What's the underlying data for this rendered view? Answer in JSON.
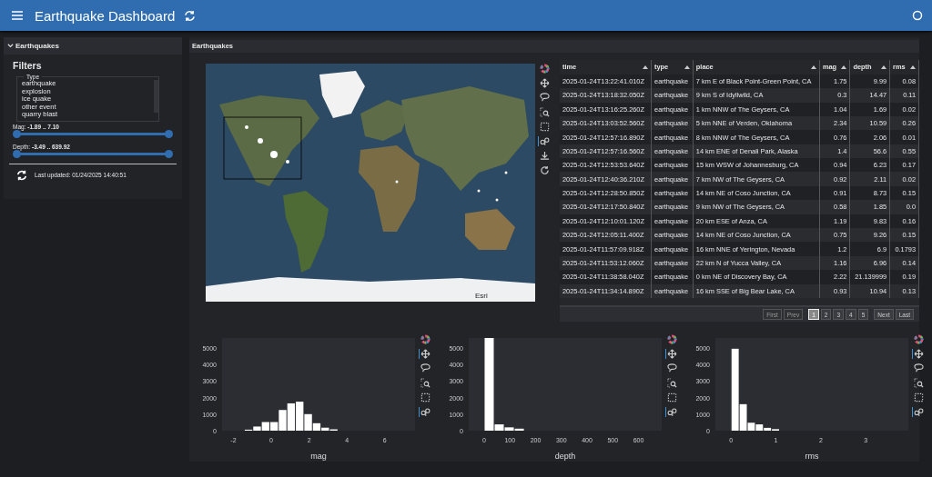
{
  "header": {
    "title": "Earthquake Dashboard"
  },
  "sidebar": {
    "section_title": "Earthquakes",
    "expanded": true,
    "heading": "Filters",
    "type_filter": {
      "label": "Type",
      "options": [
        {
          "label": "earthquake",
          "selected": false
        },
        {
          "label": "explosion",
          "selected": false
        },
        {
          "label": "ice quake",
          "selected": false
        },
        {
          "label": "other event",
          "selected": false
        },
        {
          "label": "quarry blast",
          "selected": false
        }
      ]
    },
    "sliders": [
      {
        "label": "Mag: **-1.89 .. 7.10**",
        "level": 1
      },
      {
        "label": "Depth: **-3.49 .. 639.92**",
        "level": 1
      }
    ],
    "last_updated": "Last updated: 01/24/2025 14:40:51"
  },
  "main": {
    "title": "Earthquakes",
    "map": {
      "attribution": "Esri",
      "toolbar": [
        {
          "kind": "logo",
          "active": false
        },
        {
          "kind": "pan",
          "active": false
        },
        {
          "kind": "lasso",
          "active": false
        },
        {
          "kind": "zoom",
          "active": false
        },
        {
          "kind": "select",
          "active": false
        },
        {
          "kind": "hover",
          "active": true
        },
        {
          "kind": "save",
          "active": false
        },
        {
          "kind": "reset",
          "active": false
        }
      ]
    },
    "table": {
      "columns": [
        "time",
        "type",
        "place",
        "mag",
        "depth",
        "rms"
      ],
      "rows": [
        [
          "2025-01-24T13:22:41.010Z",
          "earthquake",
          "7 km E of Black Point-Green Point, CA",
          "1.75",
          "9.99",
          "0.08"
        ],
        [
          "2025-01-24T13:18:32.050Z",
          "earthquake",
          "9 km S of Idyllwild, CA",
          "0.3",
          "14.47",
          "0.11"
        ],
        [
          "2025-01-24T13:16:25.260Z",
          "earthquake",
          "1 km NNW of The Geysers, CA",
          "1.04",
          "1.69",
          "0.02"
        ],
        [
          "2025-01-24T13:03:52.560Z",
          "earthquake",
          "5 km NNE of Verden, Oklahoma",
          "2.34",
          "10.59",
          "0.26"
        ],
        [
          "2025-01-24T12:57:16.890Z",
          "earthquake",
          "8 km NNW of The Geysers, CA",
          "0.76",
          "2.06",
          "0.01"
        ],
        [
          "2025-01-24T12:57:16.560Z",
          "earthquake",
          "14 km ENE of Denali Park, Alaska",
          "1.4",
          "56.6",
          "0.55"
        ],
        [
          "2025-01-24T12:53:53.640Z",
          "earthquake",
          "15 km WSW of Johannesburg, CA",
          "0.94",
          "6.23",
          "0.17"
        ],
        [
          "2025-01-24T12:40:36.210Z",
          "earthquake",
          "7 km NW of The Geysers, CA",
          "0.92",
          "2.11",
          "0.02"
        ],
        [
          "2025-01-24T12:28:50.850Z",
          "earthquake",
          "14 km NE of Coso Junction, CA",
          "0.91",
          "8.73",
          "0.15"
        ],
        [
          "2025-01-24T12:17:50.840Z",
          "earthquake",
          "9 km NW of The Geysers, CA",
          "0.58",
          "1.85",
          "0.0"
        ],
        [
          "2025-01-24T12:10:01.120Z",
          "earthquake",
          "20 km ESE of Anza, CA",
          "1.19",
          "9.83",
          "0.16"
        ],
        [
          "2025-01-24T12:05:11.400Z",
          "earthquake",
          "14 km NE of Coso Junction, CA",
          "0.75",
          "9.26",
          "0.15"
        ],
        [
          "2025-01-24T11:57:09.918Z",
          "earthquake",
          "16 km NNE of Yerington, Nevada",
          "1.2",
          "6.9",
          "0.1793"
        ],
        [
          "2025-01-24T11:53:12.060Z",
          "earthquake",
          "22 km N of Yucca Valley, CA",
          "1.16",
          "6.96",
          "0.14"
        ],
        [
          "2025-01-24T11:38:58.040Z",
          "earthquake",
          "0 km NE of Discovery Bay, CA",
          "2.22",
          "21.139999",
          "0.19"
        ],
        [
          "2025-01-24T11:34:14.890Z",
          "earthquake",
          "16 km SSE of Big Bear Lake, CA",
          "0.93",
          "10.94",
          "0.13"
        ]
      ]
    },
    "pagination": [
      {
        "label": "First",
        "disabled": true,
        "selected": false
      },
      {
        "label": "Prev",
        "disabled": true,
        "selected": false
      },
      {
        "label": "1",
        "disabled": false,
        "selected": true
      },
      {
        "label": "2",
        "disabled": false,
        "selected": false
      },
      {
        "label": "3",
        "disabled": false,
        "selected": false
      },
      {
        "label": "4",
        "disabled": false,
        "selected": false
      },
      {
        "label": "5",
        "disabled": false,
        "selected": false
      },
      {
        "label": "Next",
        "disabled": false,
        "selected": false
      },
      {
        "label": "Last",
        "disabled": false,
        "selected": false
      }
    ]
  },
  "histograms": [
    {
      "toolbar": [
        {
          "kind": "logo",
          "active": false
        },
        {
          "kind": "pan",
          "active": true
        },
        {
          "kind": "lasso",
          "active": false
        },
        {
          "kind": "zoom",
          "active": false
        },
        {
          "kind": "select",
          "active": false
        },
        {
          "kind": "hover",
          "active": true
        }
      ],
      "chart_data": {
        "type": "bar",
        "xlabel": "mag",
        "x": [
          -1.2,
          -0.75,
          -0.3,
          0.15,
          0.6,
          1.05,
          1.5,
          1.95,
          2.4,
          2.85,
          3.3
        ],
        "values": [
          60,
          250,
          520,
          520,
          1250,
          1650,
          1750,
          1000,
          450,
          180,
          80
        ],
        "xlim": [
          -2.6,
          7.6
        ],
        "ylim": [
          0,
          5600
        ],
        "xticks": [
          -2,
          0,
          2,
          4,
          6
        ],
        "yticks": [
          0,
          1000,
          2000,
          3000,
          4000,
          5000
        ]
      }
    },
    {
      "toolbar": [
        {
          "kind": "logo",
          "active": false
        },
        {
          "kind": "pan",
          "active": true
        },
        {
          "kind": "lasso",
          "active": false
        },
        {
          "kind": "zoom",
          "active": false
        },
        {
          "kind": "select",
          "active": false
        },
        {
          "kind": "hover",
          "active": true
        }
      ],
      "chart_data": {
        "type": "bar",
        "xlabel": "depth",
        "x": [
          19.5,
          58.5,
          97.5,
          136.5
        ],
        "values": [
          5600,
          380,
          200,
          120
        ],
        "xlim": [
          -60,
          690
        ],
        "ylim": [
          0,
          5600
        ],
        "xticks": [
          0,
          100,
          200,
          300,
          400,
          500,
          600
        ],
        "yticks": [
          0,
          1000,
          2000,
          3000,
          4000,
          5000
        ]
      }
    },
    {
      "toolbar": [
        {
          "kind": "logo",
          "active": false
        },
        {
          "kind": "pan",
          "active": true
        },
        {
          "kind": "lasso",
          "active": false
        },
        {
          "kind": "zoom",
          "active": false
        },
        {
          "kind": "select",
          "active": false
        },
        {
          "kind": "hover",
          "active": true
        }
      ],
      "chart_data": {
        "type": "bar",
        "xlabel": "rms",
        "x": [
          0.09,
          0.27,
          0.45,
          0.63,
          0.81,
          0.99
        ],
        "values": [
          4950,
          1600,
          480,
          380,
          170,
          90
        ],
        "xlim": [
          -0.35,
          3.95
        ],
        "ylim": [
          0,
          5600
        ],
        "xticks": [
          0,
          1,
          2,
          3
        ],
        "yticks": [
          0,
          1000,
          2000,
          3000,
          4000,
          5000
        ]
      }
    }
  ]
}
